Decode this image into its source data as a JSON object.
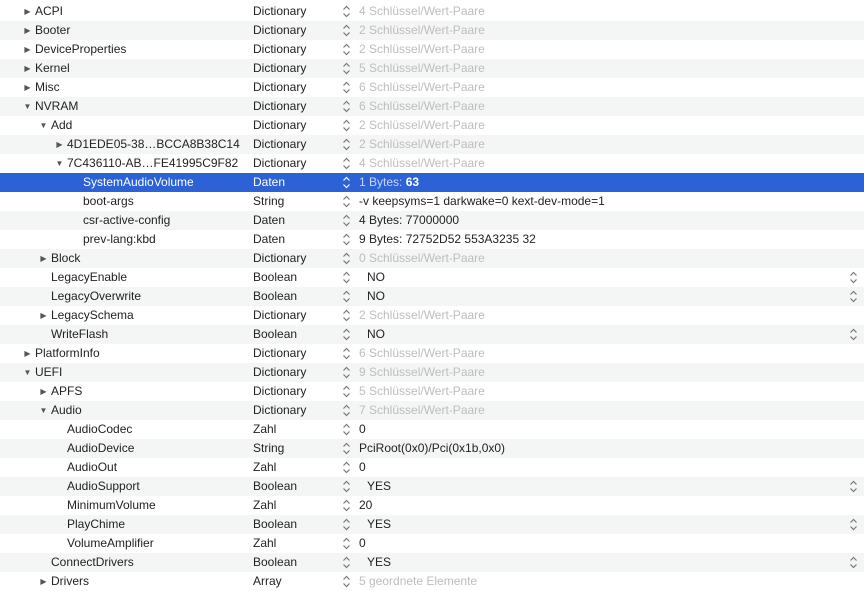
{
  "rows": [
    {
      "key": "ACPI",
      "indent": 0,
      "disc": "closed",
      "type": "Dictionary",
      "value": "4 Schlüssel/Wert-Paare",
      "muted": true
    },
    {
      "key": "Booter",
      "indent": 0,
      "disc": "closed",
      "type": "Dictionary",
      "value": "2 Schlüssel/Wert-Paare",
      "muted": true
    },
    {
      "key": "DeviceProperties",
      "indent": 0,
      "disc": "closed",
      "type": "Dictionary",
      "value": "2 Schlüssel/Wert-Paare",
      "muted": true
    },
    {
      "key": "Kernel",
      "indent": 0,
      "disc": "closed",
      "type": "Dictionary",
      "value": "5 Schlüssel/Wert-Paare",
      "muted": true
    },
    {
      "key": "Misc",
      "indent": 0,
      "disc": "closed",
      "type": "Dictionary",
      "value": "6 Schlüssel/Wert-Paare",
      "muted": true
    },
    {
      "key": "NVRAM",
      "indent": 0,
      "disc": "open",
      "type": "Dictionary",
      "value": "6 Schlüssel/Wert-Paare",
      "muted": true
    },
    {
      "key": "Add",
      "indent": 1,
      "disc": "open",
      "type": "Dictionary",
      "value": "2 Schlüssel/Wert-Paare",
      "muted": true
    },
    {
      "key": "4D1EDE05-38…BCCA8B38C14",
      "indent": 2,
      "disc": "closed",
      "type": "Dictionary",
      "value": "2 Schlüssel/Wert-Paare",
      "muted": true
    },
    {
      "key": "7C436110-AB…FE41995C9F82",
      "indent": 2,
      "disc": "open",
      "type": "Dictionary",
      "value": "4 Schlüssel/Wert-Paare",
      "muted": true
    },
    {
      "key": "SystemAudioVolume",
      "indent": 3,
      "disc": "none",
      "type": "Daten",
      "value_prefix": "1 Bytes: ",
      "value": "63",
      "selected": true
    },
    {
      "key": "boot-args",
      "indent": 3,
      "disc": "none",
      "type": "String",
      "value": "-v keepsyms=1 darkwake=0 kext-dev-mode=1"
    },
    {
      "key": "csr-active-config",
      "indent": 3,
      "disc": "none",
      "type": "Daten",
      "value": "4 Bytes: 77000000"
    },
    {
      "key": "prev-lang:kbd",
      "indent": 3,
      "disc": "none",
      "type": "Daten",
      "value": "9 Bytes: 72752D52 553A3235 32"
    },
    {
      "key": "Block",
      "indent": 1,
      "disc": "closed",
      "type": "Dictionary",
      "value": "0 Schlüssel/Wert-Paare",
      "muted": true
    },
    {
      "key": "LegacyEnable",
      "indent": 1,
      "disc": "none",
      "type": "Boolean",
      "value": "NO",
      "bool": true
    },
    {
      "key": "LegacyOverwrite",
      "indent": 1,
      "disc": "none",
      "type": "Boolean",
      "value": "NO",
      "bool": true
    },
    {
      "key": "LegacySchema",
      "indent": 1,
      "disc": "closed",
      "type": "Dictionary",
      "value": "2 Schlüssel/Wert-Paare",
      "muted": true
    },
    {
      "key": "WriteFlash",
      "indent": 1,
      "disc": "none",
      "type": "Boolean",
      "value": "NO",
      "bool": true
    },
    {
      "key": "PlatformInfo",
      "indent": 0,
      "disc": "closed",
      "type": "Dictionary",
      "value": "6 Schlüssel/Wert-Paare",
      "muted": true
    },
    {
      "key": "UEFI",
      "indent": 0,
      "disc": "open",
      "type": "Dictionary",
      "value": "9 Schlüssel/Wert-Paare",
      "muted": true
    },
    {
      "key": "APFS",
      "indent": 1,
      "disc": "closed",
      "type": "Dictionary",
      "value": "5 Schlüssel/Wert-Paare",
      "muted": true
    },
    {
      "key": "Audio",
      "indent": 1,
      "disc": "open",
      "type": "Dictionary",
      "value": "7 Schlüssel/Wert-Paare",
      "muted": true
    },
    {
      "key": "AudioCodec",
      "indent": 2,
      "disc": "none",
      "type": "Zahl",
      "value": "0"
    },
    {
      "key": "AudioDevice",
      "indent": 2,
      "disc": "none",
      "type": "String",
      "value": "PciRoot(0x0)/Pci(0x1b,0x0)"
    },
    {
      "key": "AudioOut",
      "indent": 2,
      "disc": "none",
      "type": "Zahl",
      "value": "0"
    },
    {
      "key": "AudioSupport",
      "indent": 2,
      "disc": "none",
      "type": "Boolean",
      "value": "YES",
      "bool": true
    },
    {
      "key": "MinimumVolume",
      "indent": 2,
      "disc": "none",
      "type": "Zahl",
      "value": "20"
    },
    {
      "key": "PlayChime",
      "indent": 2,
      "disc": "none",
      "type": "Boolean",
      "value": "YES",
      "bool": true
    },
    {
      "key": "VolumeAmplifier",
      "indent": 2,
      "disc": "none",
      "type": "Zahl",
      "value": "0"
    },
    {
      "key": "ConnectDrivers",
      "indent": 1,
      "disc": "none",
      "type": "Boolean",
      "value": "YES",
      "bool": true
    },
    {
      "key": "Drivers",
      "indent": 1,
      "disc": "closed",
      "type": "Array",
      "value": "5 geordnete Elemente",
      "muted": true
    }
  ],
  "icons": {
    "disclosure_closed": "disclosure-triangle-right-icon",
    "disclosure_open": "disclosure-triangle-down-icon",
    "stepper": "up-down-stepper-icon"
  },
  "colors": {
    "selection": "#2d62d6",
    "stripe": "#f4f5f5",
    "muted_text": "#bdbdbd"
  }
}
